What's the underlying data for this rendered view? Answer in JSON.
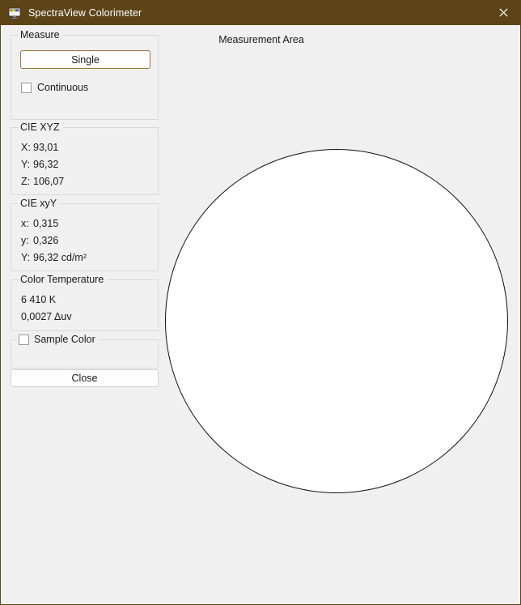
{
  "window": {
    "title": "SpectraView Colorimeter",
    "icon": "monitor-color-icon",
    "close_icon": "close-icon",
    "titlebar_color": "#5c4417",
    "client_color": "#f0f0f0"
  },
  "measure_group": {
    "legend": "Measure",
    "single_button": "Single",
    "continuous_label": "Continuous",
    "continuous_checked": false,
    "focus_border_color": "#9c7638"
  },
  "cie_xyz": {
    "legend": "CIE XYZ",
    "rows": [
      {
        "label": "X:",
        "value": "93,01"
      },
      {
        "label": "Y:",
        "value": "96,32"
      },
      {
        "label": "Z:",
        "value": "106,07"
      }
    ]
  },
  "cie_xyy": {
    "legend": "CIE xyY",
    "rows": [
      {
        "label": "x:",
        "value": "0,315"
      },
      {
        "label": "y:",
        "value": "0,326"
      },
      {
        "label": "Y:",
        "value": "96,32 cd/m²"
      }
    ]
  },
  "color_temperature": {
    "legend": "Color Temperature",
    "kelvin": "6 410 K",
    "duv": "0,0027 Δuv"
  },
  "sample_color": {
    "legend": "Sample Color",
    "checked": false
  },
  "close_button": {
    "label": "Close"
  },
  "measurement_area": {
    "label": "Measurement Area",
    "circle_fill": "#ffffff",
    "circle_stroke": "#111111"
  }
}
